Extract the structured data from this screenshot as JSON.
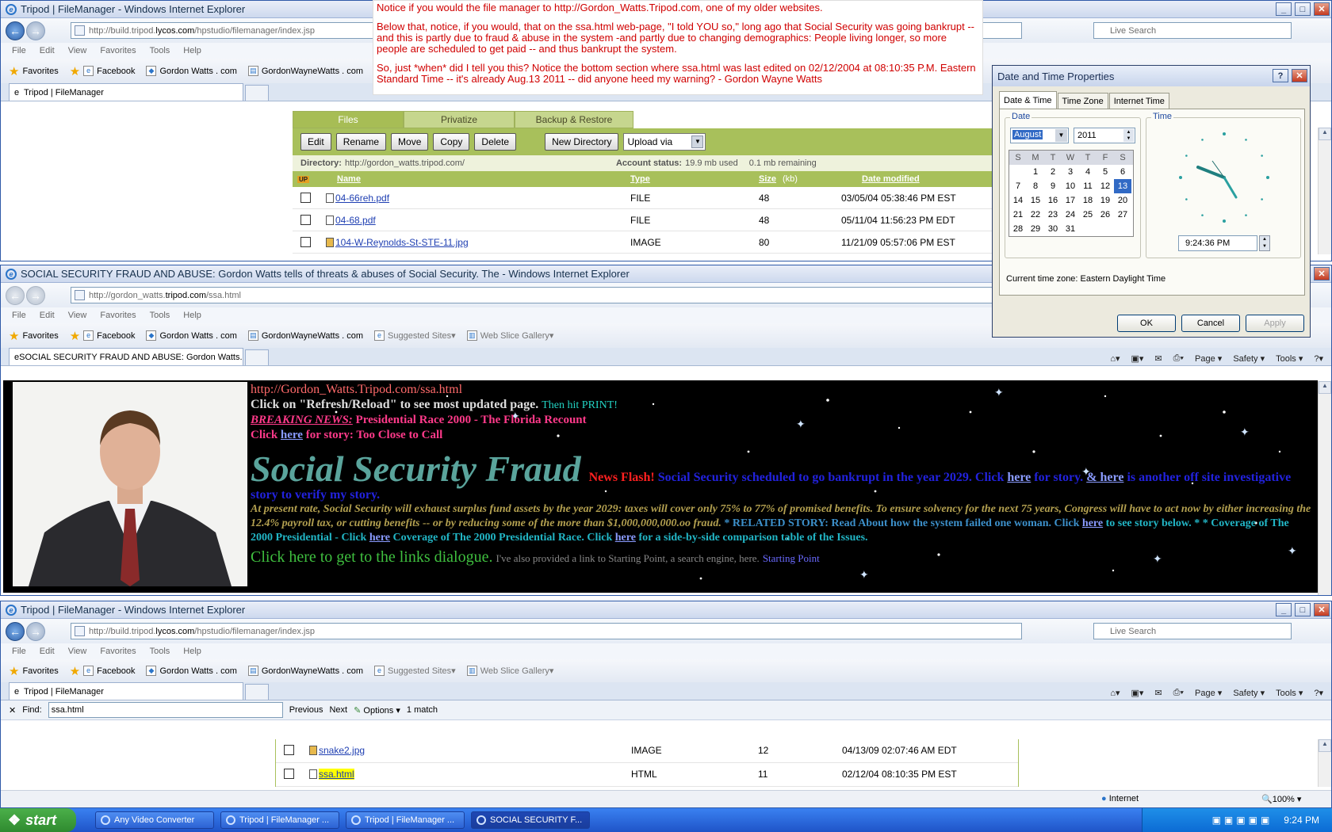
{
  "window1": {
    "title": "Tripod | FileManager - Windows Internet Explorer",
    "address_host_pre": "http://build.tripod.",
    "address_host_bold": "lycos.com",
    "address_path": "/hpstudio/filemanager/index.jsp",
    "search_placeholder": "Live Search",
    "menu": [
      "File",
      "Edit",
      "View",
      "Favorites",
      "Tools",
      "Help"
    ],
    "favorites_label": "Favorites",
    "favs": [
      "Facebook",
      "Gordon Watts . com",
      "GordonWayneWatts . com"
    ],
    "tab_label": "Tripod | FileManager",
    "fm": {
      "tabs": [
        "Files",
        "Privatize",
        "Backup & Restore"
      ],
      "buttons": [
        "Edit",
        "Rename",
        "Move",
        "Copy",
        "Delete",
        "New Directory"
      ],
      "upload_label": "Upload via",
      "directory_label": "Directory:",
      "directory_value": "http://gordon_watts.tripod.com/",
      "account_label": "Account status:",
      "account_value": "19.9 mb used",
      "remaining": "0.1 mb remaining",
      "up_label": "UP",
      "headers": {
        "name": "Name",
        "type": "Type",
        "size": "Size",
        "kb": "(kb)",
        "date": "Date modified"
      },
      "rows": [
        {
          "name": "04-66reh.pdf",
          "type": "FILE",
          "size": "48",
          "date": "03/05/04 05:38:46 PM EST"
        },
        {
          "name": "04-68.pdf",
          "type": "FILE",
          "size": "48",
          "date": "05/11/04 11:56:23 PM EDT"
        },
        {
          "name": "104-W-Reynolds-St-STE-11.jpg",
          "type": "IMAGE",
          "size": "80",
          "date": "11/21/09 05:57:06 PM EST"
        }
      ]
    }
  },
  "note": {
    "p1": "Notice if you would the file manager to http://Gordon_Watts.Tripod.com, one of my older websites.",
    "p2": "Below that, notice, if you would, that on the ssa.html web-page, \"I told YOU so,\" long ago that Social Security was going bankrupt -- and this is partly due to fraud & abuse in the system -and partly due to changing demographics: People living longer, so more people are scheduled to get paid -- and thus bankrupt the system.",
    "p3": "So, just *when* did I tell you this? Notice the bottom section where ssa.html was last edited on 02/12/2004 at 08:10:35 P.M. Eastern Standard Time -- it's already Aug.13 2011 -- did anyone heed my warning? - Gordon Wayne Watts"
  },
  "dialog": {
    "title": "Date and Time Properties",
    "tabs": [
      "Date & Time",
      "Time Zone",
      "Internet Time"
    ],
    "date_label": "Date",
    "time_label": "Time",
    "month": "August",
    "year": "2011",
    "weekdays": [
      "S",
      "M",
      "T",
      "W",
      "T",
      "F",
      "S"
    ],
    "weeks": [
      [
        "",
        "1",
        "2",
        "3",
        "4",
        "5",
        "6"
      ],
      [
        "7",
        "8",
        "9",
        "10",
        "11",
        "12",
        "13"
      ],
      [
        "14",
        "15",
        "16",
        "17",
        "18",
        "19",
        "20"
      ],
      [
        "21",
        "22",
        "23",
        "24",
        "25",
        "26",
        "27"
      ],
      [
        "28",
        "29",
        "30",
        "31",
        "",
        "",
        ""
      ]
    ],
    "selected_day": "13",
    "time_value": "9:24:36 PM",
    "timezone_label": "Current time zone:",
    "timezone_value": "Eastern Daylight Time",
    "ok": "OK",
    "cancel": "Cancel",
    "apply": "Apply"
  },
  "window2": {
    "title": "SOCIAL SECURITY FRAUD AND ABUSE: Gordon Watts tells of threats & abuses of Social Security. The - Windows Internet Explorer",
    "address_pre": "http://gordon_watts.",
    "address_bold": "tripod.com",
    "address_path": "/ssa.html",
    "menu": [
      "File",
      "Edit",
      "View",
      "Favorites",
      "Tools",
      "Help"
    ],
    "favorites_label": "Favorites",
    "favs": [
      "Facebook",
      "Gordon Watts . com",
      "GordonWayneWatts . com",
      "Suggested Sites",
      "Web Slice Gallery"
    ],
    "tab_label": "SOCIAL SECURITY FRAUD AND ABUSE: Gordon Watts...",
    "cmd": [
      "Page",
      "Safety",
      "Tools"
    ],
    "page": {
      "url": "http://Gordon_Watts.Tripod.com/ssa.html",
      "refresh": "Click on \"Refresh/Reload\" to see most updated page.",
      "print": "Then hit PRINT!",
      "breaking": "BREAKING NEWS:",
      "breaking_text": "Presidential Race 2000 - The Florida Recount",
      "click": "Click",
      "here": "here",
      "for_story": "for story: Too Close to Call",
      "headline": "Social Security Fraud",
      "newsflash": "News Flash!",
      "scheduled": "Social Security scheduled to go bankrupt in the year 2029. Click",
      "for_story2": "for story.",
      "and_here": "& here",
      "investigative": "is another off site investigative story to verify my story.",
      "at_present": "At present rate, Social Security will exhaust surplus fund assets by the year 2029: taxes will cover only 75% to 77% of promised benefits. To ensure solvency for the next 75 years, Congress will have to act now by either increasing the 12.4% payroll tax, or cutting benefits -- or by reducing some of the more than $1,000,000,000.oo fraud.",
      "related": "* RELATED STORY: Read About how the system failed one woman. Click",
      "to_see": "to see story below. * * Coverage of The 2000 Presidential - Click",
      "coverage": "Coverage of The 2000 Presidential Race. Click",
      "sidebyside": "for a side-by-side comparison table of the Issues.",
      "click_here_links": "Click here to get to the links dialogue.",
      "starting": "I've also provided a link to Starting Point, a search engine, here.",
      "starting_link": "Starting Point"
    }
  },
  "window3": {
    "title": "Tripod | FileManager - Windows Internet Explorer",
    "address_host_pre": "http://build.tripod.",
    "address_host_bold": "lycos.com",
    "address_path": "/hpstudio/filemanager/index.jsp",
    "search_placeholder": "Live Search",
    "menu": [
      "File",
      "Edit",
      "View",
      "Favorites",
      "Tools",
      "Help"
    ],
    "favorites_label": "Favorites",
    "favs": [
      "Facebook",
      "Gordon Watts . com",
      "GordonWayneWatts . com",
      "Suggested Sites",
      "Web Slice Gallery"
    ],
    "tab_label": "Tripod | FileManager",
    "cmd": [
      "Page",
      "Safety",
      "Tools"
    ],
    "find_label": "Find:",
    "find_value": "ssa.html",
    "prev": "Previous",
    "next": "Next",
    "options": "Options",
    "matches": "1 match",
    "rows": [
      {
        "name": "snake2.jpg",
        "type": "IMAGE",
        "size": "12",
        "date": "04/13/09 02:07:46 AM EDT"
      },
      {
        "name": "ssa.html",
        "type": "HTML",
        "size": "11",
        "date": "02/12/04 08:10:35 PM EST"
      }
    ],
    "status_zone": "Internet",
    "zoom": "100%"
  },
  "taskbar": {
    "start": "start",
    "items": [
      "Any Video Converter",
      "Tripod | FileManager ...",
      "Tripod | FileManager ...",
      "SOCIAL SECURITY F..."
    ],
    "clock": "9:24 PM"
  }
}
